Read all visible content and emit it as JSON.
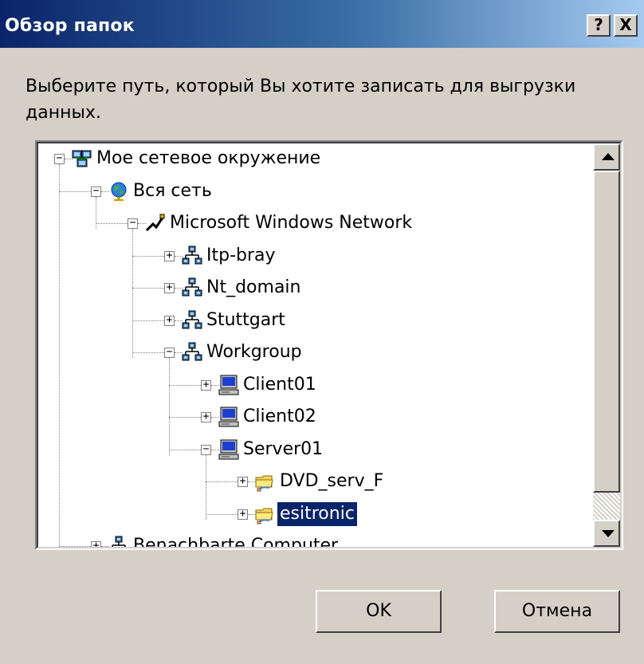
{
  "window": {
    "title": "Обзор папок",
    "help_label": "?",
    "close_label": "X"
  },
  "prompt": "Выберите путь, который Вы хотите записать для выгрузки данных.",
  "tree": {
    "nodes": [
      {
        "label": "Мое сетевое окружение",
        "expander": "−",
        "icon": "network-places-icon"
      },
      {
        "label": "Вся сеть",
        "expander": "−",
        "icon": "globe-icon"
      },
      {
        "label": "Microsoft Windows Network",
        "expander": "−",
        "icon": "network-provider-icon"
      },
      {
        "label": "Itp-bray",
        "expander": "+",
        "icon": "domain-icon"
      },
      {
        "label": "Nt_domain",
        "expander": "+",
        "icon": "domain-icon"
      },
      {
        "label": "Stuttgart",
        "expander": "+",
        "icon": "domain-icon"
      },
      {
        "label": "Workgroup",
        "expander": "−",
        "icon": "domain-icon"
      },
      {
        "label": "Client01",
        "expander": "+",
        "icon": "computer-icon"
      },
      {
        "label": "Client02",
        "expander": "+",
        "icon": "computer-icon"
      },
      {
        "label": "Server01",
        "expander": "−",
        "icon": "computer-icon"
      },
      {
        "label": "DVD_serv_F",
        "expander": "+",
        "icon": "shared-folder-icon"
      },
      {
        "label": "esitronic",
        "expander": "+",
        "icon": "shared-folder-icon",
        "selected": true
      },
      {
        "label": "Benachbarte Computer",
        "expander": "+",
        "icon": "domain-icon"
      }
    ]
  },
  "buttons": {
    "ok": "OK",
    "cancel": "Отмена"
  }
}
